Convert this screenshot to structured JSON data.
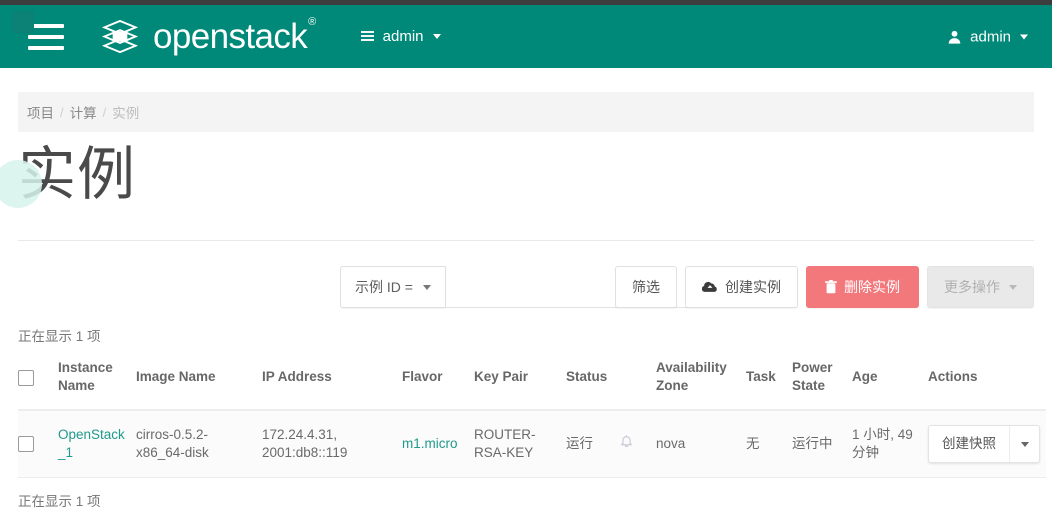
{
  "header": {
    "brand": "openstack",
    "brand_mark": "®",
    "project": "admin",
    "user": "admin",
    "menu_icon": "hamburger-icon",
    "project_icon": "grid-icon",
    "user_icon": "user-icon"
  },
  "breadcrumb": {
    "items": [
      "项目",
      "计算",
      "实例"
    ],
    "separator": "/"
  },
  "page": {
    "title": "实例"
  },
  "toolbar": {
    "filter_select_label": "示例 ID =",
    "filter_input_value": "",
    "filter_input_placeholder": "",
    "filter_button": "筛选",
    "create_button": "创建实例",
    "delete_button": "删除实例",
    "more_button": "更多操作",
    "create_icon": "cloud-upload-icon",
    "delete_icon": "trash-icon",
    "danger_color": "#f2787c",
    "accent_color": "#008878"
  },
  "table": {
    "count_top": "正在显示 1 项",
    "count_bottom": "正在显示 1 项",
    "columns": [
      "Instance Name",
      "Image Name",
      "IP Address",
      "Flavor",
      "Key Pair",
      "Status",
      "Availability Zone",
      "Task",
      "Power State",
      "Age",
      "Actions"
    ],
    "rows": [
      {
        "instance_name": "OpenStack_1",
        "image_name": "cirros-0.5.2-x86_64-disk",
        "ip_address": "172.24.4.31, 2001:db8::119",
        "flavor": "m1.micro",
        "key_pair": "ROUTER-RSA-KEY",
        "status": "运行",
        "alarm_icon": "bell-icon",
        "availability_zone": "nova",
        "task": "无",
        "power_state": "运行中",
        "age": "1 小时, 49 分钟",
        "action_label": "创建快照",
        "action_caret": "chevron-down-icon"
      }
    ]
  }
}
